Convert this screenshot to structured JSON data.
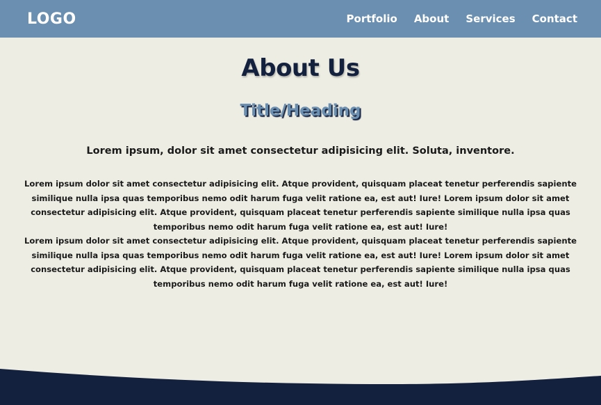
{
  "header": {
    "logo": "LOGO",
    "nav": [
      {
        "label": "Portfolio"
      },
      {
        "label": "About"
      },
      {
        "label": "Services"
      },
      {
        "label": "Contact"
      }
    ]
  },
  "main": {
    "title": "About Us",
    "subheading": "Title/Heading",
    "lead": "Lorem ipsum, dolor sit amet consectetur adipisicing elit. Soluta, inventore.",
    "paragraphs": [
      "Lorem ipsum dolor sit amet consectetur adipisicing elit. Atque provident, quisquam placeat tenetur perferendis sapiente similique nulla ipsa quas temporibus nemo odit harum fuga velit ratione ea, est aut! Iure! Lorem ipsum dolor sit amet consectetur adipisicing elit. Atque provident, quisquam placeat tenetur perferendis sapiente similique nulla ipsa quas temporibus nemo odit harum fuga velit ratione ea, est aut! Iure!",
      "Lorem ipsum dolor sit amet consectetur adipisicing elit. Atque provident, quisquam placeat tenetur perferendis sapiente similique nulla ipsa quas temporibus nemo odit harum fuga velit ratione ea, est aut! Iure! Lorem ipsum dolor sit amet consectetur adipisicing elit. Atque provident, quisquam placeat tenetur perferendis sapiente similique nulla ipsa quas temporibus nemo odit harum fuga velit ratione ea, est aut! Iure!"
    ]
  },
  "colors": {
    "navbar": "#6a8fb0",
    "background": "#eeede3",
    "dark": "#13213f"
  }
}
